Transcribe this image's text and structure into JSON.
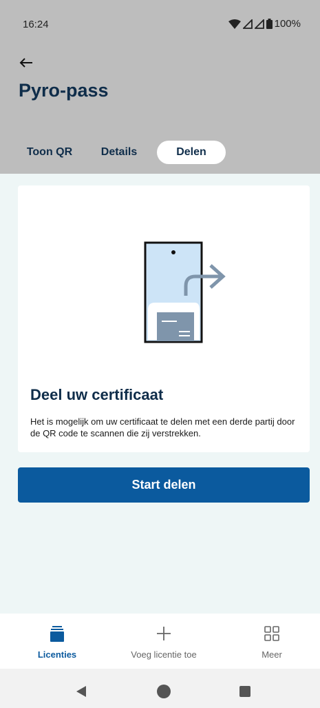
{
  "status_bar": {
    "time": "16:24",
    "battery": "100%",
    "icons": [
      "wifi-icon",
      "signal-icon",
      "signal-icon",
      "battery-icon"
    ]
  },
  "header": {
    "title": "Pyro-pass",
    "back_icon": "arrow-left-icon"
  },
  "tabs": [
    {
      "label": "Toon QR",
      "active": false
    },
    {
      "label": "Details",
      "active": false
    },
    {
      "label": "Delen",
      "active": true
    }
  ],
  "card": {
    "illustration": "phone-share-icon",
    "title": "Deel uw certificaat",
    "text": "Het is mogelijk om uw certificaat te delen met een derde partij door de QR code te scannen die zij verstrekken."
  },
  "start_button": {
    "label": "Start delen"
  },
  "bottom_nav": [
    {
      "label": "Licenties",
      "icon": "licenses-stack-icon",
      "active": true
    },
    {
      "label": "Voeg licentie toe",
      "icon": "plus-icon",
      "active": false
    },
    {
      "label": "Meer",
      "icon": "grid-icon",
      "active": false
    }
  ],
  "colors": {
    "header_bg": "#bdbdbd",
    "content_bg": "#eef6f6",
    "primary": "#0b5a9e",
    "title": "#0f2d4a"
  }
}
